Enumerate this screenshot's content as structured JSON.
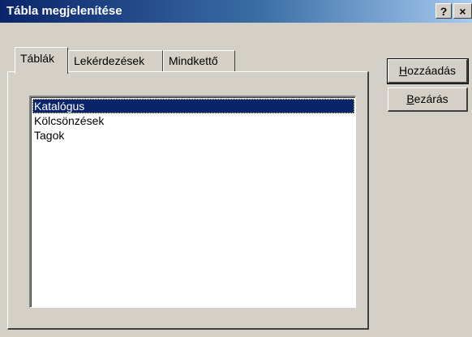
{
  "window": {
    "title": "Tábla megjelenítése",
    "help_button": "?",
    "close_button": "×"
  },
  "tabs": [
    {
      "label": "Táblák",
      "active": true
    },
    {
      "label": "Lekérdezések",
      "active": false
    },
    {
      "label": "Mindkettő",
      "active": false
    }
  ],
  "list": {
    "items": [
      {
        "label": "Katalógus",
        "selected": true
      },
      {
        "label": "Kölcsönzések",
        "selected": false
      },
      {
        "label": "Tagok",
        "selected": false
      }
    ]
  },
  "buttons": {
    "add": {
      "first_letter": "H",
      "rest": "ozzáadás"
    },
    "close": {
      "first_letter": "B",
      "rest": "ezárás"
    }
  },
  "colors": {
    "face": "#d4d0c8",
    "title_gradient_start": "#0a246a",
    "title_gradient_end": "#a6caf0",
    "selection": "#0a246a"
  }
}
